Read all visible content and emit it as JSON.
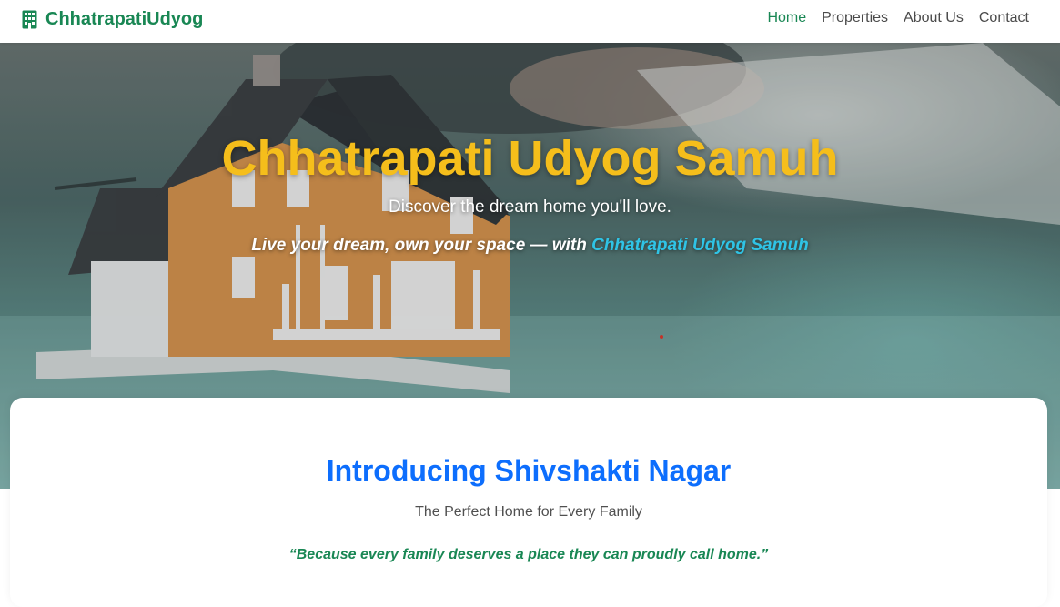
{
  "navbar": {
    "brand_icon": "building-icon",
    "brand": "ChhatrapatiUdyog",
    "links": [
      {
        "label": "Home",
        "active": true
      },
      {
        "label": "Properties",
        "active": false
      },
      {
        "label": "About Us",
        "active": false
      },
      {
        "label": "Contact",
        "active": false
      }
    ]
  },
  "hero": {
    "title": "Chhatrapati Udyog Samuh",
    "subtitle": "Discover the dream home you'll love.",
    "tagline_prefix": "Live your dream, own your space — with ",
    "tagline_highlight": "Chhatrapati Udyog Samuh"
  },
  "intro": {
    "title": "Introducing Shivshakti Nagar",
    "subtitle": "The Perfect Home for Every Family",
    "quote": "“Because every family deserves a place they can proudly call home.”"
  },
  "colors": {
    "brand_green": "#198754",
    "hero_title": "#f5be1b",
    "highlight_cyan": "#2fc4e6",
    "intro_blue": "#0d6efd"
  }
}
